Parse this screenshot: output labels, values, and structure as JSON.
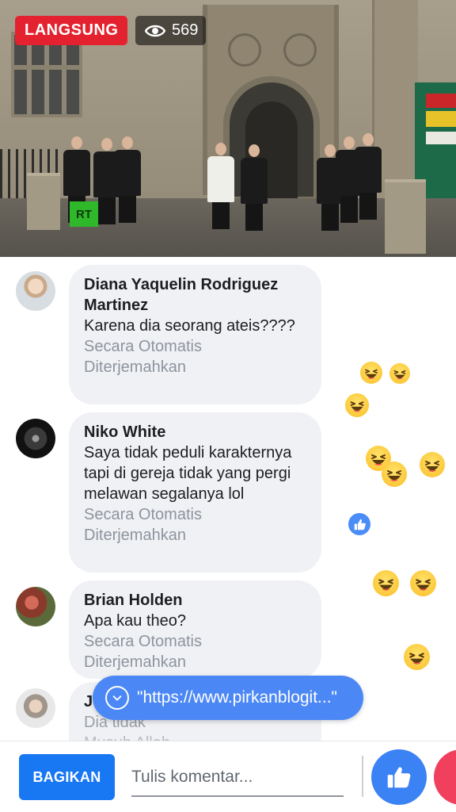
{
  "video": {
    "live_label": "LANGSUNG",
    "viewer_count": "569",
    "channel_logo": "RT"
  },
  "comments": [
    {
      "name": "Diana Yaquelin Rodriguez Martinez",
      "text": "Karena dia seorang ateis????",
      "translation_note": "Secara Otomatis Diterjemahkan"
    },
    {
      "name": "Niko White",
      "text": "Saya tidak peduli karakternya tapi di gereja tidak yang pergi melawan segalanya lol",
      "translation_note": "Secara Otomatis Diterjemahkan"
    },
    {
      "name": "Brian Holden",
      "text": "Apa kau theo?",
      "translation_note": "Secara Otomatis Diterjemahkan"
    },
    {
      "name": "J",
      "text": "Dia tidak",
      "text2": "Musuh Allah"
    }
  ],
  "link_pill": {
    "text": "\"https://www.pirkanblogit...\""
  },
  "bottom_bar": {
    "share_label": "BAGIKAN",
    "comment_placeholder": "Tulis komentar..."
  },
  "colors": {
    "live_red": "#e4222f",
    "facebook_blue": "#1877f2",
    "pill_blue": "#4c88f5",
    "bubble_gray": "#f0f1f4",
    "love_red": "#f0405e"
  },
  "icons": [
    "eye-icon",
    "chevron-down-icon",
    "thumbs-up-icon",
    "haha-reaction-icon",
    "love-reaction-icon"
  ]
}
